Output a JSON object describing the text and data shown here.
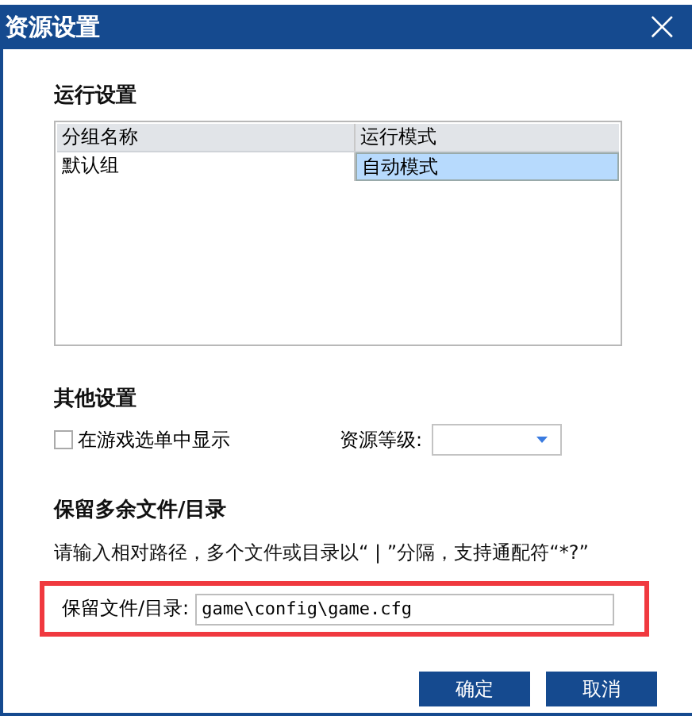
{
  "window": {
    "title": "资源设置",
    "close": "×"
  },
  "run_settings": {
    "heading": "运行设置",
    "table": {
      "columns": [
        "分组名称",
        "运行模式"
      ],
      "rows": [
        {
          "cells": [
            {
              "text": "默认组",
              "selected": false
            },
            {
              "text": "自动模式",
              "selected": true
            }
          ]
        }
      ]
    }
  },
  "other_settings": {
    "heading": "其他设置",
    "show_in_menu": {
      "label": "在游戏选单中显示",
      "checked": false
    },
    "resource_level": {
      "label": "资源等级:"
    }
  },
  "keep_files": {
    "heading": "保留多余文件/目录",
    "description": "请输入相对路径，多个文件或目录以“ | ”分隔，支持通配符“*?”",
    "field": {
      "label": "保留文件/目录:",
      "value": "game\\config\\game.cfg",
      "highlighted": true
    }
  },
  "buttons": [
    "确定",
    "取消"
  ]
}
